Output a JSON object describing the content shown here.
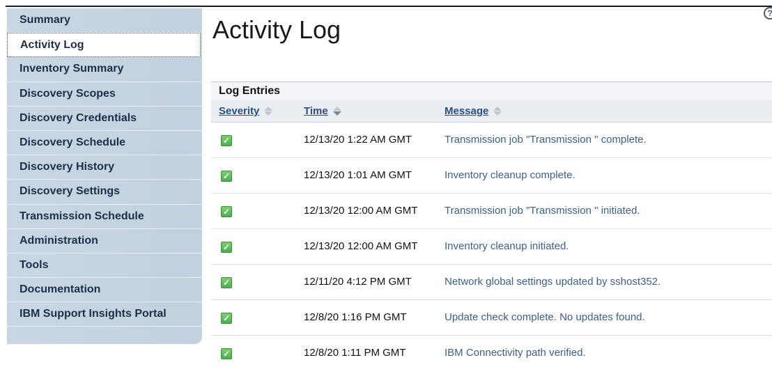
{
  "sidebar": {
    "items": [
      {
        "label": "Summary"
      },
      {
        "label": "Activity Log"
      },
      {
        "label": "Inventory Summary"
      },
      {
        "label": "Discovery Scopes"
      },
      {
        "label": "Discovery Credentials"
      },
      {
        "label": "Discovery Schedule"
      },
      {
        "label": "Discovery History"
      },
      {
        "label": "Discovery Settings"
      },
      {
        "label": "Transmission Schedule"
      },
      {
        "label": "Administration"
      },
      {
        "label": "Tools"
      },
      {
        "label": "Documentation"
      },
      {
        "label": "IBM Support Insights Portal"
      }
    ],
    "active_index": 1
  },
  "page": {
    "title": "Activity Log",
    "help_icon": "?"
  },
  "log": {
    "panel_title": "Log Entries",
    "columns": {
      "severity": "Severity",
      "time": "Time",
      "message": "Message"
    },
    "rows": [
      {
        "severity": "success",
        "time": "12/13/20 1:22 AM GMT",
        "message": "Transmission job \"Transmission \" complete."
      },
      {
        "severity": "success",
        "time": "12/13/20 1:01 AM GMT",
        "message": "Inventory cleanup complete."
      },
      {
        "severity": "success",
        "time": "12/13/20 12:00 AM GMT",
        "message": "Transmission job \"Transmission \" initiated."
      },
      {
        "severity": "success",
        "time": "12/13/20 12:00 AM GMT",
        "message": "Inventory cleanup initiated."
      },
      {
        "severity": "success",
        "time": "12/11/20 4:12 PM GMT",
        "message": "Network global settings updated by sshost352."
      },
      {
        "severity": "success",
        "time": "12/8/20 1:16 PM GMT",
        "message": "Update check complete. No updates found."
      },
      {
        "severity": "success",
        "time": "12/8/20 1:11 PM GMT",
        "message": "IBM Connectivity path verified."
      }
    ]
  },
  "colors": {
    "sidebar_bg": "#c9d7e4",
    "link": "#2a4d8a",
    "message_text": "#3c5f8c",
    "success": "#4caf50"
  }
}
